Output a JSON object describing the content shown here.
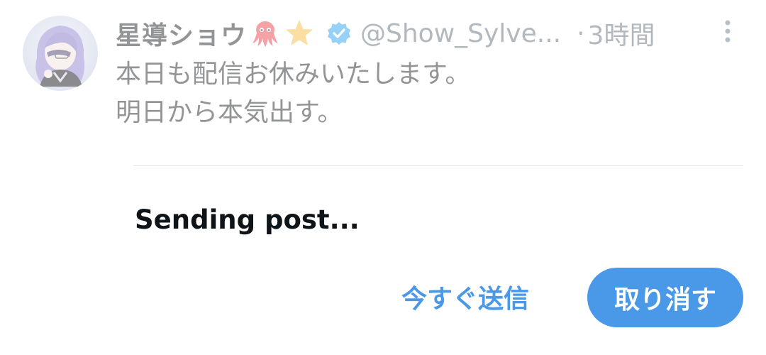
{
  "post": {
    "author": {
      "display_name": "星導ショウ",
      "handle": "@Show_Sylve...",
      "avatar_icon": "avatar-character",
      "emojis": [
        "octopus-emoji",
        "star-emoji"
      ],
      "verified": true,
      "verified_color": "#1d9bf0"
    },
    "timestamp": "3時間",
    "separator": "·",
    "text_lines": [
      "本日も配信お休みいたします。",
      "明日から本気出す。"
    ]
  },
  "status": {
    "message": "Sending post..."
  },
  "actions": {
    "send_now_label": "今すぐ送信",
    "undo_label": "取り消す"
  },
  "colors": {
    "accent": "#4a99e9",
    "text": "#0f1419",
    "secondary": "#536471"
  }
}
